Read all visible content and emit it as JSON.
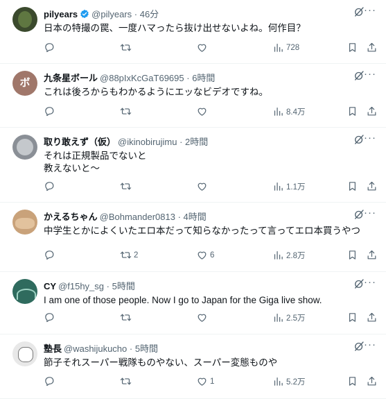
{
  "tweets": [
    {
      "name": "pilyears",
      "handle": "@pilyears",
      "time": "46分",
      "verified": true,
      "text": "日本の特撮の罠、一度ハマったら抜け出せないよね。何作目？",
      "replies": "",
      "retweets": "",
      "likes": "",
      "views": "728",
      "avatar_color": "#3b4a2d"
    },
    {
      "name": "九条星ボール",
      "handle": "@88pIxKcGaT69695",
      "time": "6時間",
      "verified": false,
      "text": "これは後ろからもわかるようにエッなビデオですね。",
      "replies": "",
      "retweets": "",
      "likes": "",
      "views": "8.4万",
      "avatar_color": "#a0776a",
      "avatar_text": "ボ"
    },
    {
      "name": "取り敢えず（仮）",
      "handle": "@ikinobirujimu",
      "time": "2時間",
      "verified": false,
      "text": "それは正規製品でないと\n教えないと～",
      "replies": "",
      "retweets": "",
      "likes": "",
      "views": "1.1万",
      "avatar_color": "#8a8f96"
    },
    {
      "name": "かえるちゃん",
      "handle": "@Bohmander0813",
      "time": "4時間",
      "verified": false,
      "text": "中学生とかによくいたエロ本だって知らなかったって言ってエロ本買うやつ",
      "replies": "",
      "retweets": "2",
      "likes": "6",
      "views": "2.8万",
      "avatar_color": "#c9a27a"
    },
    {
      "name": "CY",
      "handle": "@f15hy_sg",
      "time": "5時間",
      "verified": false,
      "text": "I am one of those people. Now I go to Japan for the Giga live show.",
      "replies": "",
      "retweets": "",
      "likes": "",
      "views": "2.5万",
      "avatar_color": "#2f6b5e"
    },
    {
      "name": "塾長",
      "handle": "@washijukucho",
      "time": "5時間",
      "verified": false,
      "text": "節子それスーパー戦隊ものやない、スーパー変態ものや",
      "replies": "",
      "retweets": "",
      "likes": "1",
      "views": "5.2万",
      "avatar_color": "#e8e8e8"
    }
  ],
  "colors": {
    "text": "#0f1419",
    "secondary": "#536471",
    "verified": "#1d9bf0",
    "border": "#eff3f4"
  }
}
